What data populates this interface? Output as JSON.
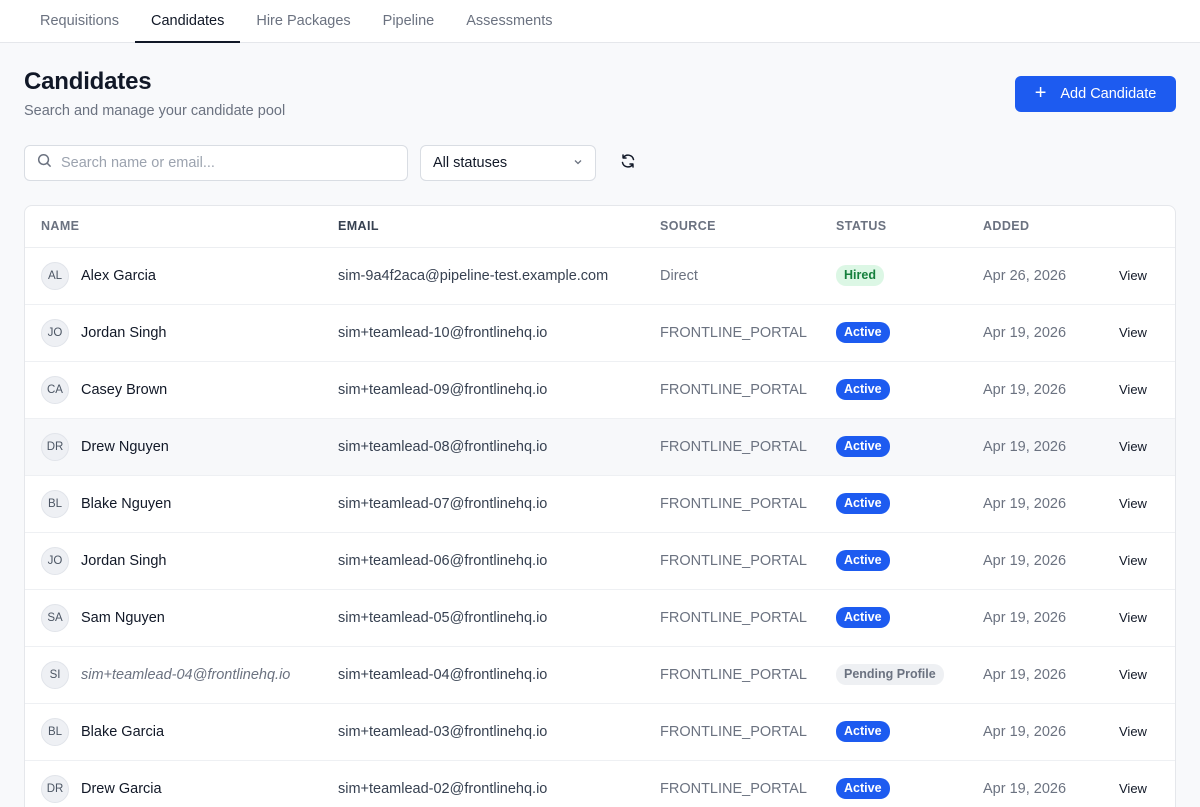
{
  "nav": {
    "tabs": [
      {
        "label": "Requisitions",
        "active": false
      },
      {
        "label": "Candidates",
        "active": true
      },
      {
        "label": "Hire Packages",
        "active": false
      },
      {
        "label": "Pipeline",
        "active": false
      },
      {
        "label": "Assessments",
        "active": false
      }
    ]
  },
  "header": {
    "title": "Candidates",
    "subtitle": "Search and manage your candidate pool",
    "add_button_label": "Add Candidate"
  },
  "filters": {
    "search_placeholder": "Search name or email...",
    "search_value": "",
    "status_selected": "All statuses"
  },
  "table": {
    "columns": [
      "NAME",
      "EMAIL",
      "SOURCE",
      "STATUS",
      "ADDED"
    ],
    "action_label": "View",
    "rows": [
      {
        "initials": "AL",
        "name": "Alex Garcia",
        "email": "sim-9a4f2aca@pipeline-test.example.com",
        "source": "Direct",
        "status": "Hired",
        "status_kind": "hired",
        "added": "Apr 26, 2026"
      },
      {
        "initials": "JO",
        "name": "Jordan Singh",
        "email": "sim+teamlead-10@frontlinehq.io",
        "source": "FRONTLINE_PORTAL",
        "status": "Active",
        "status_kind": "active",
        "added": "Apr 19, 2026"
      },
      {
        "initials": "CA",
        "name": "Casey Brown",
        "email": "sim+teamlead-09@frontlinehq.io",
        "source": "FRONTLINE_PORTAL",
        "status": "Active",
        "status_kind": "active",
        "added": "Apr 19, 2026"
      },
      {
        "initials": "DR",
        "name": "Drew Nguyen",
        "email": "sim+teamlead-08@frontlinehq.io",
        "source": "FRONTLINE_PORTAL",
        "status": "Active",
        "status_kind": "active",
        "added": "Apr 19, 2026",
        "highlight": true
      },
      {
        "initials": "BL",
        "name": "Blake Nguyen",
        "email": "sim+teamlead-07@frontlinehq.io",
        "source": "FRONTLINE_PORTAL",
        "status": "Active",
        "status_kind": "active",
        "added": "Apr 19, 2026"
      },
      {
        "initials": "JO",
        "name": "Jordan Singh",
        "email": "sim+teamlead-06@frontlinehq.io",
        "source": "FRONTLINE_PORTAL",
        "status": "Active",
        "status_kind": "active",
        "added": "Apr 19, 2026"
      },
      {
        "initials": "SA",
        "name": "Sam Nguyen",
        "email": "sim+teamlead-05@frontlinehq.io",
        "source": "FRONTLINE_PORTAL",
        "status": "Active",
        "status_kind": "active",
        "added": "Apr 19, 2026"
      },
      {
        "initials": "SI",
        "name": "sim+teamlead-04@frontlinehq.io",
        "name_italic": true,
        "email": "sim+teamlead-04@frontlinehq.io",
        "source": "FRONTLINE_PORTAL",
        "status": "Pending Profile",
        "status_kind": "pending",
        "added": "Apr 19, 2026"
      },
      {
        "initials": "BL",
        "name": "Blake Garcia",
        "email": "sim+teamlead-03@frontlinehq.io",
        "source": "FRONTLINE_PORTAL",
        "status": "Active",
        "status_kind": "active",
        "added": "Apr 19, 2026"
      },
      {
        "initials": "DR",
        "name": "Drew Garcia",
        "email": "sim+teamlead-02@frontlinehq.io",
        "source": "FRONTLINE_PORTAL",
        "status": "Active",
        "status_kind": "active",
        "added": "Apr 19, 2026"
      }
    ]
  }
}
